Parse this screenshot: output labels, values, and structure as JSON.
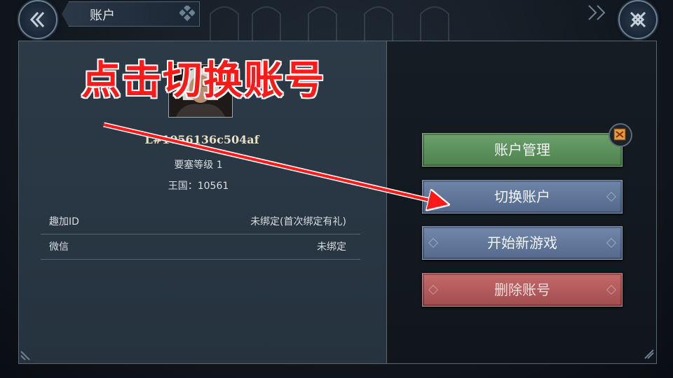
{
  "header": {
    "title": "账户",
    "back_icon": "double-chevron-left-icon",
    "close_icon": "crossed-swords-close-icon"
  },
  "profile": {
    "player_id": "L#1056136c504af",
    "fortress_level": "要塞等级 1",
    "kingdom": "王国：10561"
  },
  "bindings": [
    {
      "label": "趣加ID",
      "value": "未绑定(首次绑定有礼)"
    },
    {
      "label": "微信",
      "value": "未绑定"
    }
  ],
  "actions": {
    "manage": "账户管理",
    "switch": "切换账户",
    "new_game": "开始新游戏",
    "delete": "删除账号"
  },
  "annotation": {
    "text": "点击切换账号",
    "color": "#ff1a1a"
  },
  "colors": {
    "manage": "#5a9160",
    "switch": "#60779b",
    "delete": "#b25a5e"
  }
}
